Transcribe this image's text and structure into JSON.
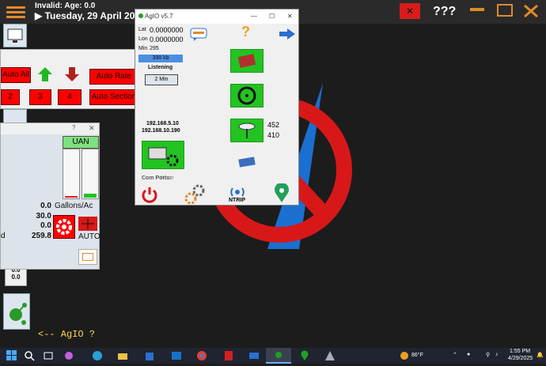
{
  "topbar": {
    "invalid_text": "Invalid: Age: 0.0",
    "date_text": "Tuesday, 29 April 2025",
    "unknown_text": "???"
  },
  "rate_settings": {
    "window_title": "?",
    "product_label": "UAN",
    "values": [
      "0.0",
      "30.0",
      "0.0",
      "259.8"
    ],
    "units_label": "Gallons/Ac",
    "auto_label": "AUTO",
    "mini_values": [
      "0.0",
      "0.0"
    ],
    "d_label": "d"
  },
  "sections": {
    "auto_all_label": "Auto All",
    "auto_rate_label": "Auto Rate",
    "auto_section_label": "Auto Section",
    "section_buttons": [
      "2",
      "3",
      "4"
    ]
  },
  "agio": {
    "window_title": "AgIO v5.7",
    "lat_label": "Lat",
    "lat_value": "0.0000000",
    "lon_label": "Lon",
    "lon_value": "0.0000000",
    "min_label": "Min",
    "min_value": "295",
    "kb_value": "398 kb",
    "listening_text": "Listening",
    "interval_button": "2 Min",
    "ip1": "192.168.5.10",
    "ip2": "192.168.10.190",
    "count1": "452",
    "count2": "410",
    "com_ports_label": "Com Ports:",
    "com_ports_value": "None",
    "ntrip_label": "NTRIP",
    "question_text": "?"
  },
  "bottom": {
    "agio_hint": "<-- AgIO ?"
  },
  "taskbar": {
    "temperature": "86°F",
    "time": "1:55 PM",
    "date": "4/29/2025"
  },
  "colors": {
    "accent_orange": "#e08a2c",
    "alert_red": "#ff0000",
    "tile_green": "#22c322"
  }
}
